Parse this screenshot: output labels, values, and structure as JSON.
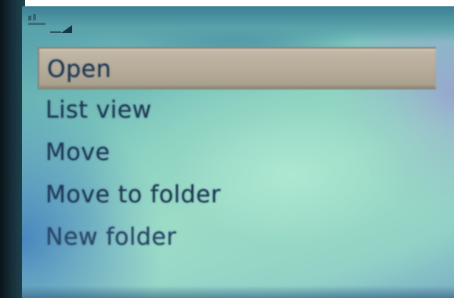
{
  "menu": {
    "items": [
      {
        "label": "Open",
        "selected": true
      },
      {
        "label": "List view",
        "selected": false
      },
      {
        "label": "Move",
        "selected": false
      },
      {
        "label": "Move to folder",
        "selected": false
      },
      {
        "label": "New folder",
        "selected": false
      }
    ]
  },
  "status_bar": {
    "icons": [
      "signal-strength-icon"
    ]
  },
  "colors": {
    "screen_background": "#8fd2c4",
    "selection_highlight": "#b8ae9c",
    "text": "#1f3a56"
  }
}
